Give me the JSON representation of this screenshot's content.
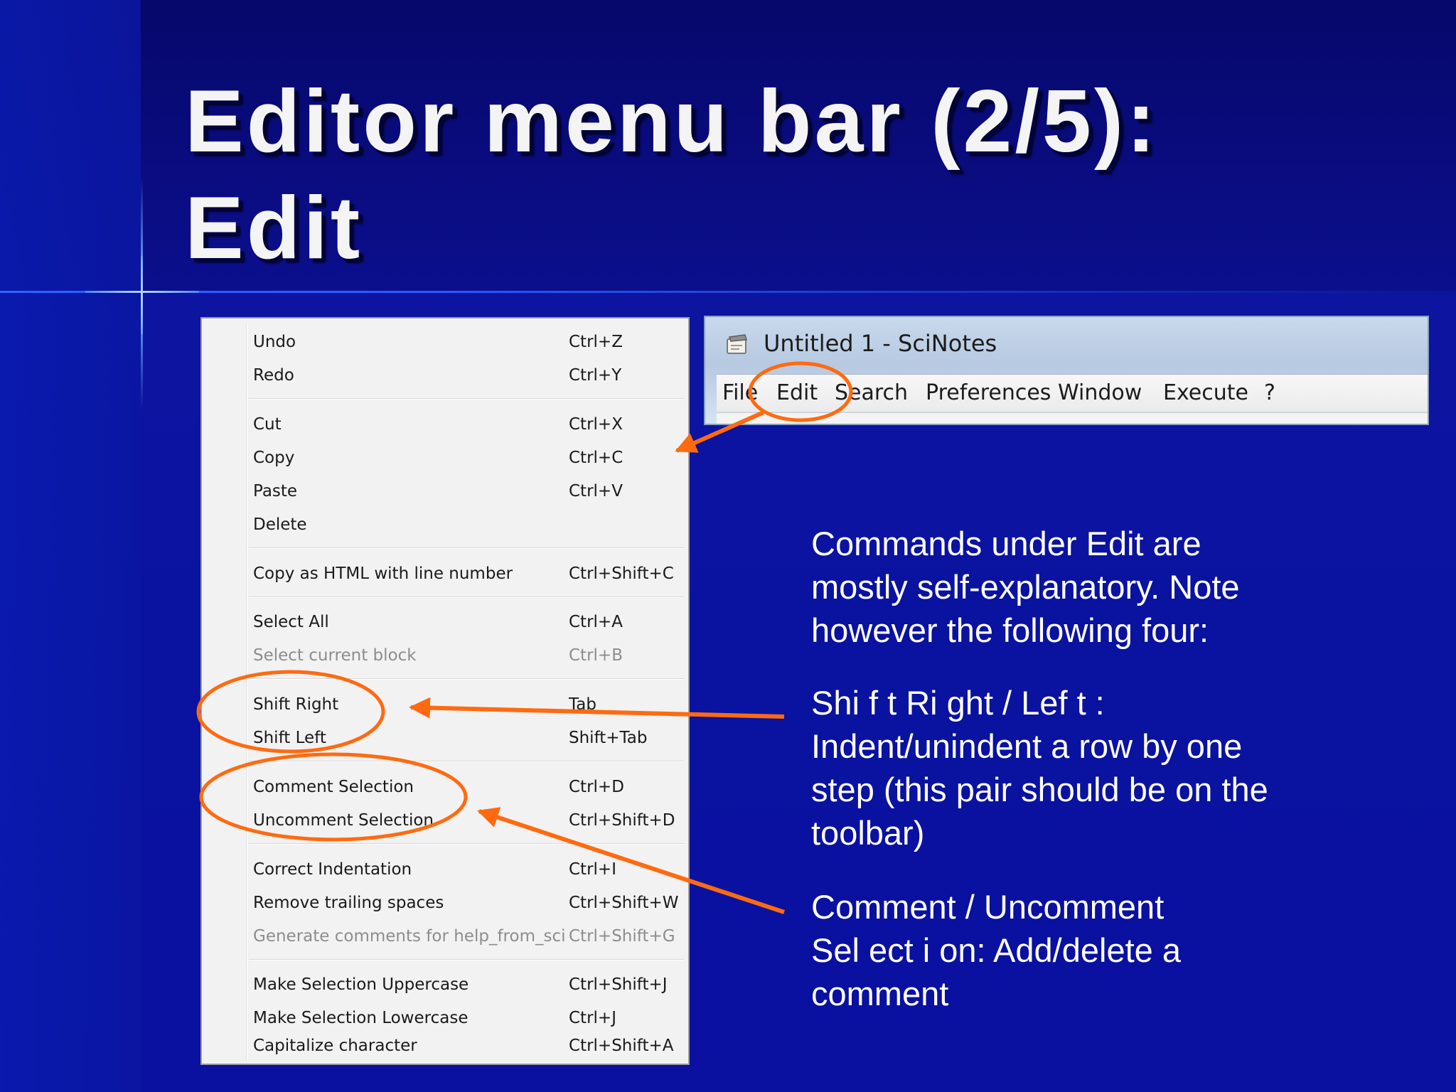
{
  "slide": {
    "title_line1": "Editor menu bar (2/5):",
    "title_line2": "Edit"
  },
  "edit_menu": {
    "items": [
      {
        "label": "Undo",
        "shortcut": "Ctrl+Z",
        "enabled": true
      },
      {
        "label": "Redo",
        "shortcut": "Ctrl+Y",
        "enabled": true
      },
      {
        "label": "Cut",
        "shortcut": "Ctrl+X",
        "enabled": true
      },
      {
        "label": "Copy",
        "shortcut": "Ctrl+C",
        "enabled": true
      },
      {
        "label": "Paste",
        "shortcut": "Ctrl+V",
        "enabled": true
      },
      {
        "label": "Delete",
        "shortcut": "",
        "enabled": true
      },
      {
        "label": "Copy as HTML with line number",
        "shortcut": "Ctrl+Shift+C",
        "enabled": true
      },
      {
        "label": "Select All",
        "shortcut": "Ctrl+A",
        "enabled": true
      },
      {
        "label": "Select current block",
        "shortcut": "Ctrl+B",
        "enabled": false
      },
      {
        "label": "Shift Right",
        "shortcut": "Tab",
        "enabled": true
      },
      {
        "label": "Shift Left",
        "shortcut": "Shift+Tab",
        "enabled": true
      },
      {
        "label": "Comment Selection",
        "shortcut": "Ctrl+D",
        "enabled": true
      },
      {
        "label": "Uncomment Selection",
        "shortcut": "Ctrl+Shift+D",
        "enabled": true
      },
      {
        "label": "Correct Indentation",
        "shortcut": "Ctrl+I",
        "enabled": true
      },
      {
        "label": "Remove trailing spaces",
        "shortcut": "Ctrl+Shift+W",
        "enabled": true
      },
      {
        "label": "Generate comments for help_from_sci",
        "shortcut": "Ctrl+Shift+G",
        "enabled": false
      },
      {
        "label": "Make Selection Uppercase",
        "shortcut": "Ctrl+Shift+J",
        "enabled": true
      },
      {
        "label": "Make Selection Lowercase",
        "shortcut": "Ctrl+J",
        "enabled": true
      },
      {
        "label": "Capitalize character",
        "shortcut": "Ctrl+Shift+A",
        "enabled": true
      }
    ]
  },
  "scinotes_window": {
    "title": "Untitled 1 - SciNotes",
    "icon": "scinotes-app-icon",
    "menubar": [
      "File",
      "Edit",
      "Search",
      "Preferences",
      "Window",
      "Execute",
      "?"
    ]
  },
  "annotations": {
    "intro": [
      "Commands under Edit are",
      "mostly self-explanatory. Note",
      "however the following four:"
    ],
    "shift": [
      "Shi f t   Ri ght / Lef t :",
      "Indent/unindent a row by one",
      "step (this pair should be on the",
      "toolbar)"
    ],
    "comment": [
      "Comment / Uncomment",
      "Sel ect i on: Add/delete a",
      "comment"
    ]
  },
  "colors": {
    "background": "#0a0f8a",
    "highlight": "#ff6a10",
    "title_text": "#f4f4f4"
  }
}
